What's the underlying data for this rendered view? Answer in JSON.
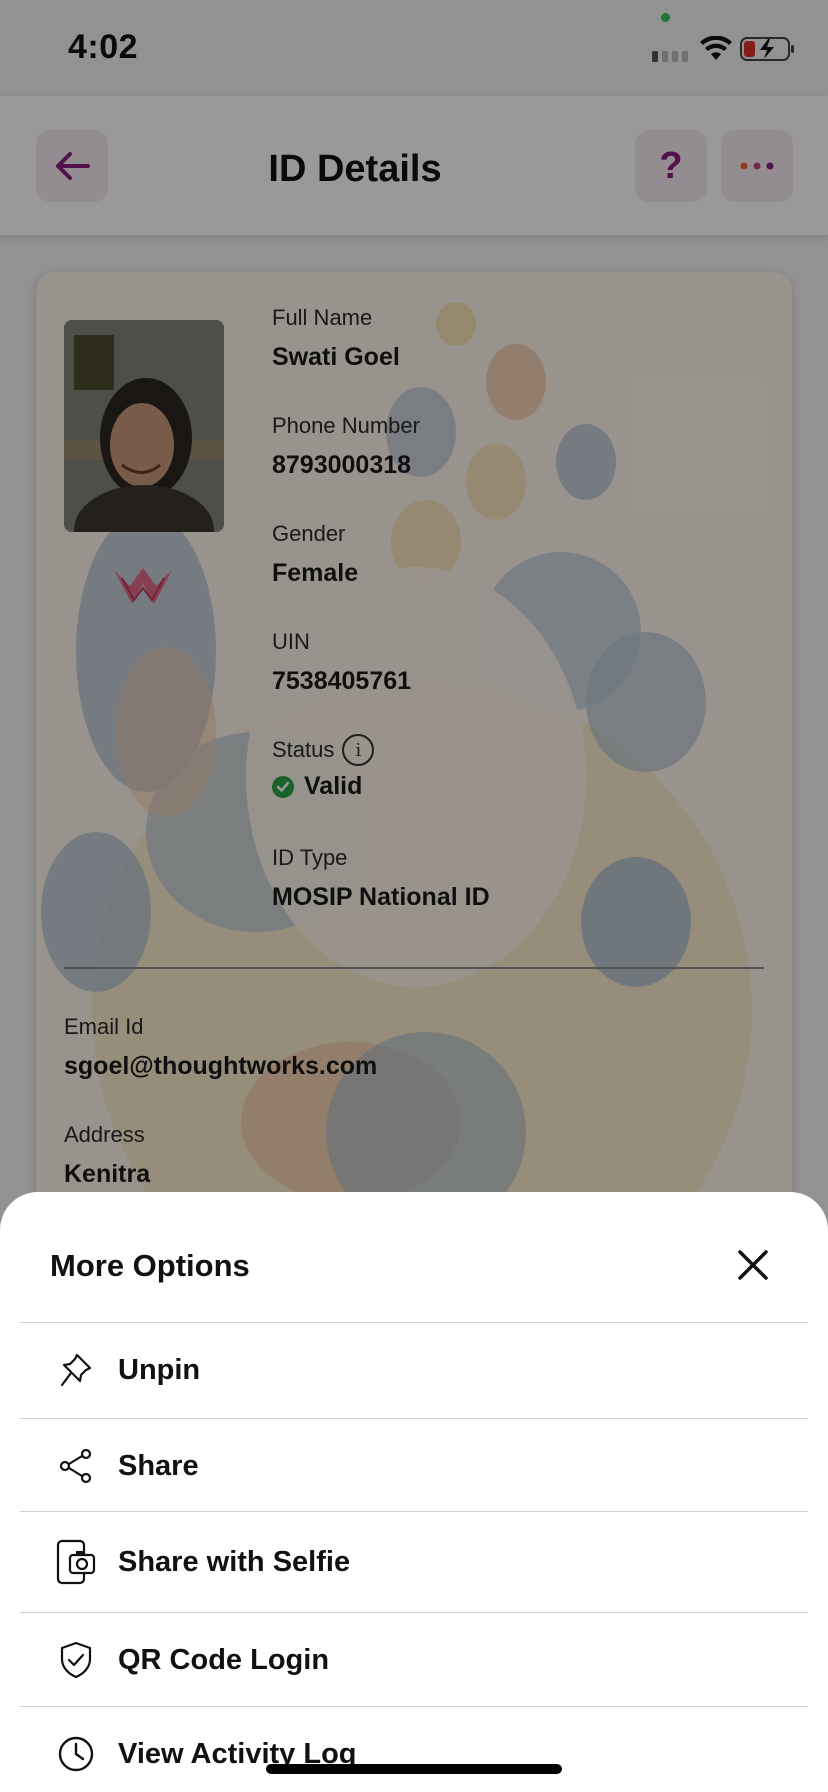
{
  "status_bar": {
    "time": "4:02"
  },
  "header": {
    "title": "ID Details",
    "help_symbol": "?"
  },
  "card": {
    "fields": [
      {
        "label": "Full Name",
        "value": "Swati Goel"
      },
      {
        "label": "Phone Number",
        "value": "8793000318"
      },
      {
        "label": "Gender",
        "value": "Female"
      },
      {
        "label": "UIN",
        "value": "7538405761"
      }
    ],
    "status": {
      "label": "Status",
      "value": "Valid",
      "info_symbol": "i"
    },
    "id_type": {
      "label": "ID Type",
      "value": "MOSIP National ID"
    },
    "email": {
      "label": "Email Id",
      "value": "sgoel@thoughtworks.com"
    },
    "address": {
      "label": "Address",
      "value": "Kenitra"
    }
  },
  "sheet": {
    "title": "More Options",
    "options": [
      {
        "label": "Unpin",
        "icon": "pin-icon"
      },
      {
        "label": "Share",
        "icon": "share-icon"
      },
      {
        "label": "Share with Selfie",
        "icon": "selfie-share-icon"
      },
      {
        "label": "QR Code Login",
        "icon": "shield-check-icon"
      },
      {
        "label": "View Activity Log",
        "icon": "clock-icon"
      }
    ]
  },
  "colors": {
    "accent": "#8a1d7d",
    "valid": "#2aa145",
    "dots": [
      "#e8682e",
      "#8a1d7d"
    ]
  }
}
